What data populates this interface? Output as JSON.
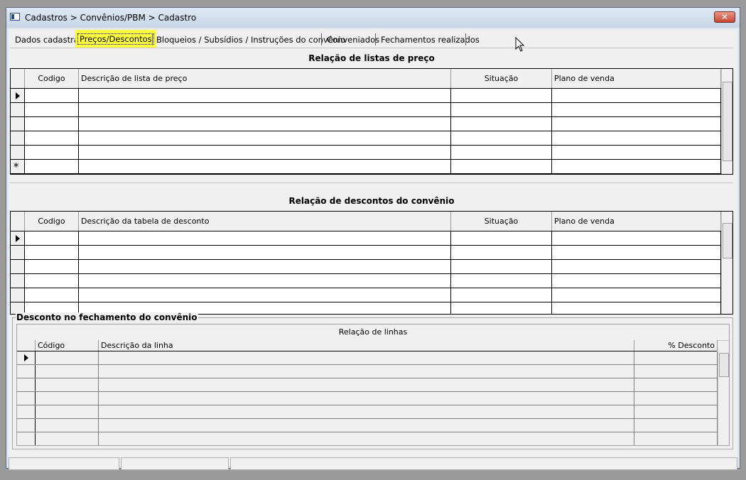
{
  "window": {
    "title": "Cadastros > Convênios/PBM > Cadastro",
    "close_label": "✕"
  },
  "tabs": [
    {
      "label": "Dados cadastrais"
    },
    {
      "label": "Preços/Descontos",
      "active": true
    },
    {
      "label": "Bloqueios / Subsídios / Instruções do convênio"
    },
    {
      "label": "Conveniados"
    },
    {
      "label": "Fechamentos realizados"
    }
  ],
  "price_lists": {
    "title": "Relação de listas de preço",
    "columns": [
      "Codigo",
      "Descrição de lista de preço",
      "Situação",
      "Plano de venda"
    ]
  },
  "discounts": {
    "title": "Relação de descontos do convênio",
    "columns": [
      "Codigo",
      "Descrição da tabela de desconto",
      "Situação",
      "Plano de venda"
    ]
  },
  "closing_discount": {
    "legend": "Desconto no fechamento do convênio",
    "caption": "Relação de linhas",
    "columns": [
      "Código",
      "Descrição da linha",
      "% Desconto"
    ]
  },
  "markers": {
    "new_row": "*"
  }
}
